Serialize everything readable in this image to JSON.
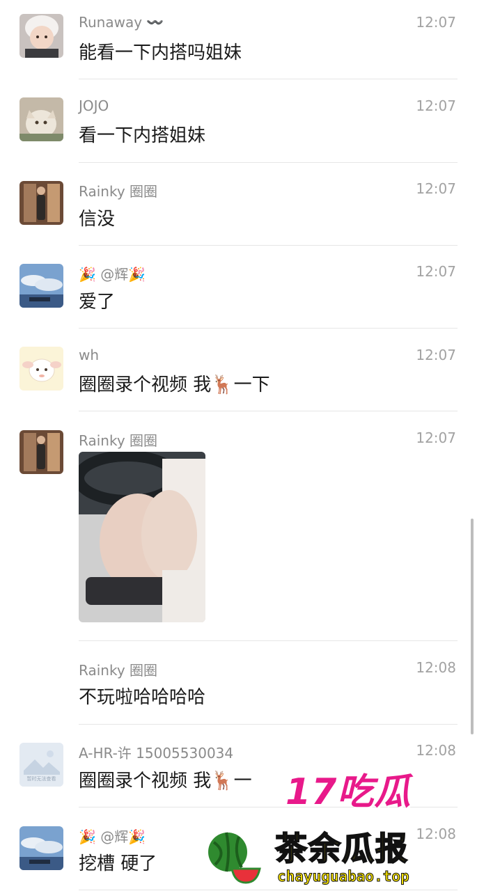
{
  "messages": [
    {
      "sender": "Runaway 〰️",
      "time": "12:07",
      "text": "能看一下内搭吗姐妹",
      "avatar": "baby-avatar"
    },
    {
      "sender": "JOJO",
      "time": "12:07",
      "text": "看一下内搭姐妹",
      "avatar": "cat-avatar"
    },
    {
      "sender": "Rainky 圈圈",
      "time": "12:07",
      "text": "信没",
      "avatar": "selfie-avatar"
    },
    {
      "sender": "🎉 @辉🎉",
      "time": "12:07",
      "text": "爱了",
      "avatar": "sky-avatar"
    },
    {
      "sender": "wh",
      "time": "12:07",
      "text": "圈圈录个视频 我🦌一下",
      "avatar": "sheep-avatar"
    },
    {
      "sender": "Rainky 圈圈",
      "time": "12:07",
      "text": "",
      "avatar": "selfie-avatar",
      "image": "photo-message"
    },
    {
      "sender": "Rainky 圈圈",
      "time": "12:08",
      "text": "不玩啦哈哈哈哈",
      "avatar": ""
    },
    {
      "sender": "A-HR-许 15005530034",
      "time": "12:08",
      "text": "圈圈录个视频 我🦌一",
      "avatar": "placeholder-avatar",
      "avatar_caption": "暂时无法查看"
    },
    {
      "sender": "🎉 @辉🎉",
      "time": "12:08",
      "text": "挖槽 硬了",
      "avatar": "sky-avatar"
    }
  ],
  "watermark": {
    "brand": "17吃瓜",
    "title": "茶余瓜报",
    "url": "chayuguabao.top"
  },
  "colors": {
    "sender": "#8a8a8a",
    "time": "#a2a2a2",
    "text": "#1a1a1a",
    "divider": "#e6e6e6",
    "brand_pink": "#e8198a",
    "brand_yellow": "#f5e100"
  }
}
